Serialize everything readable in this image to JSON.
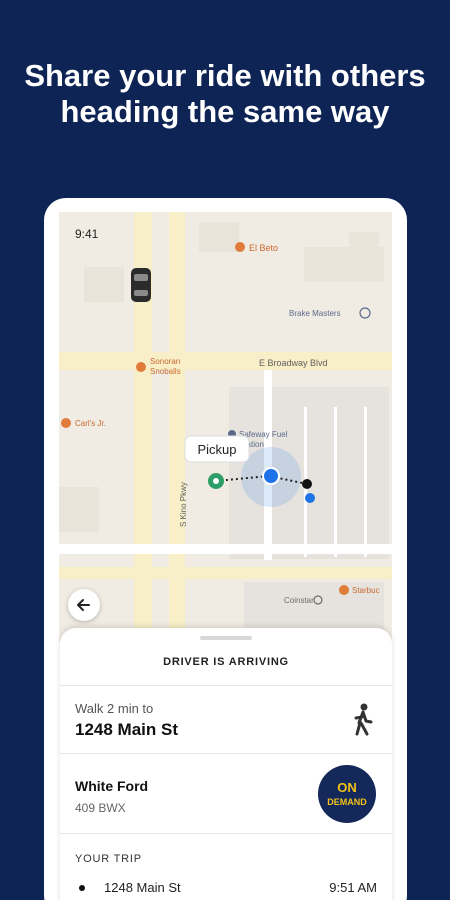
{
  "headline": {
    "line1": "Share your ride with others",
    "line2": "heading the same way"
  },
  "status_bar": {
    "time": "9:41"
  },
  "map": {
    "labels": {
      "el_belo": "El Beto",
      "brake_masters": "Brake Masters",
      "broadway": "E Broadway Blvd",
      "sonoran_1": "Sonoran",
      "sonoran_2": "Snoballs",
      "carls": "Carl's Jr.",
      "safeway_1": "Safeway Fuel",
      "safeway_2": "Station",
      "kino": "S Kino Pkwy",
      "coinstar": "Coinstar",
      "starbucks": "Starbuc"
    },
    "pickup_tooltip": "Pickup"
  },
  "sheet": {
    "title": "DRIVER IS ARRIVING",
    "walk_label": "Walk 2 min to",
    "address": "1248 Main St",
    "vehicle": "White Ford",
    "plate": "409 BWX",
    "logo_text_1": "ON",
    "logo_text_2": "DEMAND",
    "trip_label": "YOUR TRIP",
    "trip_stop_address": "1248 Main St",
    "trip_stop_time": "9:51 AM"
  },
  "colors": {
    "background": "#0d2454",
    "accent_blue": "#1e73e8",
    "pickup_green": "#2e9e68",
    "poi_orange": "#e07b39",
    "logo_bg": "#14285a",
    "logo_text": "#f3c319"
  }
}
